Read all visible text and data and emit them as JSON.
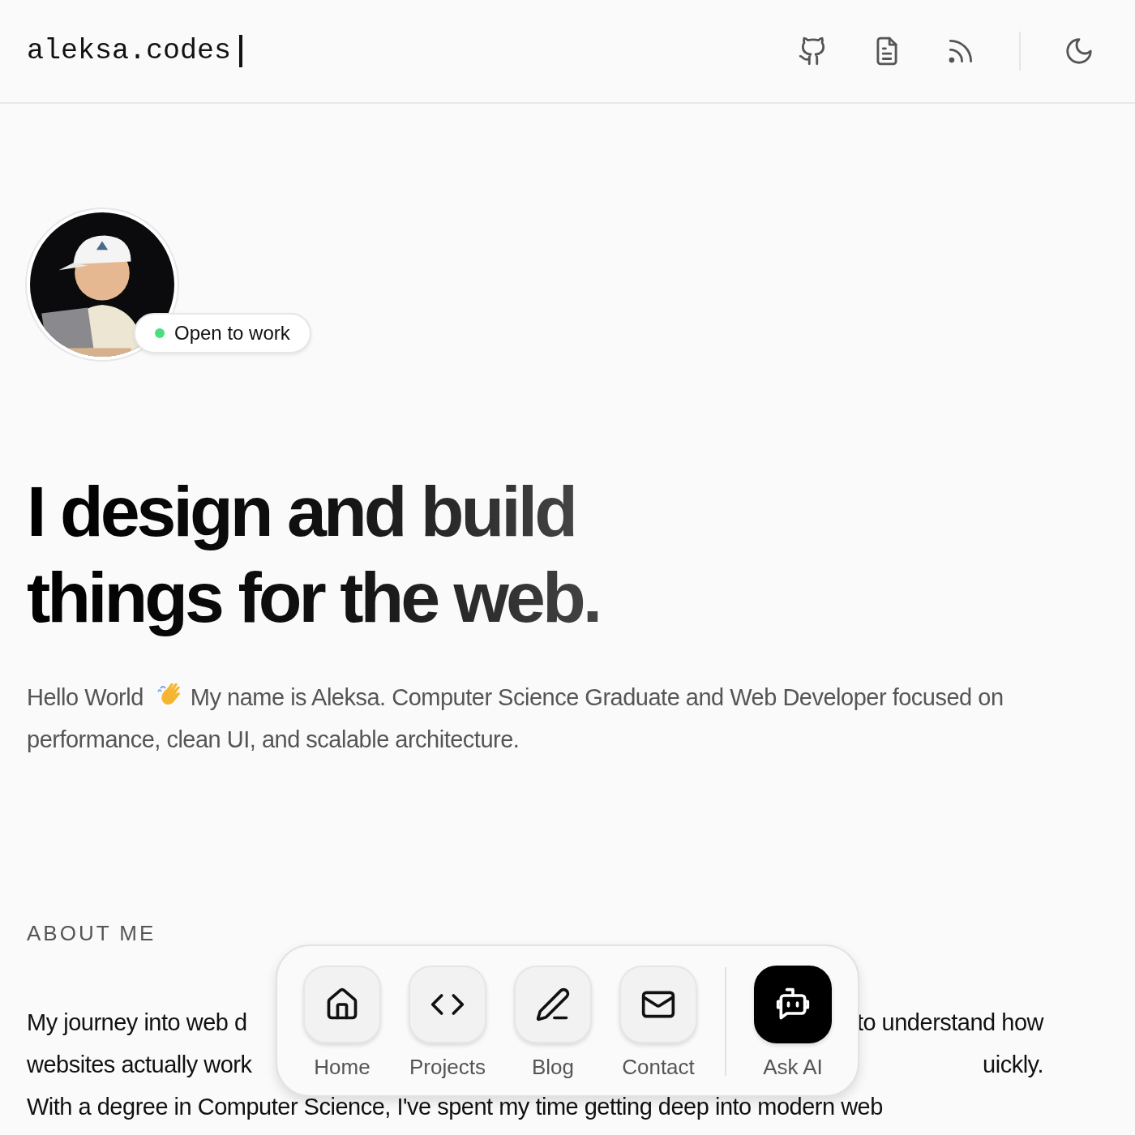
{
  "header": {
    "logo": "aleksa.codes",
    "icons": [
      {
        "kind": "github"
      },
      {
        "kind": "document"
      },
      {
        "kind": "rss"
      },
      {
        "kind": "moon"
      }
    ]
  },
  "profile": {
    "status": {
      "label": "Open to work",
      "color": "#4ade80"
    }
  },
  "hero": {
    "heading_line_1": "I design and build",
    "heading_line_2": "things for the web.",
    "greeting": "Hello World",
    "intro": "My name is Aleksa. Computer Science Graduate and Web Developer focused on performance, clean UI, and scalable architecture."
  },
  "about": {
    "title": "ABOUT ME",
    "visible_lines": [
      {
        "left": "My journey into web d",
        "right": "to understand how"
      },
      {
        "left": "websites actually work",
        "right": "uickly."
      }
    ],
    "next_line": "With a degree in Computer Science, I've spent my time getting deep into modern web"
  },
  "dock": [
    {
      "label": "Home",
      "kind": "home"
    },
    {
      "label": "Projects",
      "kind": "code"
    },
    {
      "label": "Blog",
      "kind": "pen"
    },
    {
      "label": "Contact",
      "kind": "mail"
    },
    {
      "label": "Ask AI",
      "kind": "bot"
    }
  ]
}
